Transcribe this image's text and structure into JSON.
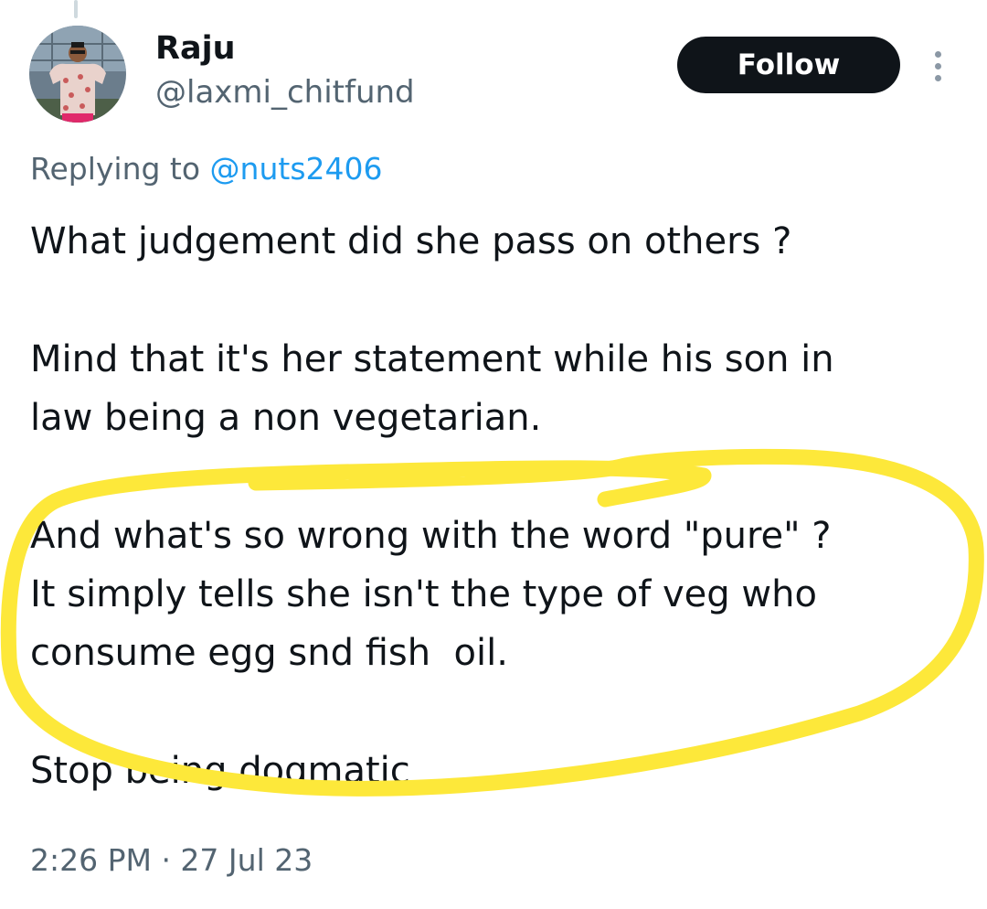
{
  "tweet": {
    "display_name": "Raju",
    "handle": "@laxmi_chitfund",
    "follow_label": "Follow",
    "replying_prefix": "Replying to",
    "replying_to": "@nuts2406",
    "paragraphs": [
      [
        "What judgement did she pass on others ?"
      ],
      [
        "Mind that it's her statement while his son in",
        "law being a non vegetarian."
      ],
      [
        "And what's so wrong with the word \"pure\" ?",
        "It simply tells she isn't the type of veg who",
        "consume egg snd fish  oil."
      ],
      [
        "Stop being dogmatic"
      ]
    ],
    "timestamp": "2:26 PM · 27 Jul 23"
  },
  "annotation": {
    "color": "#fde83a"
  },
  "icons": {
    "more": "more-vertical-icon",
    "avatar": "avatar-photo"
  }
}
